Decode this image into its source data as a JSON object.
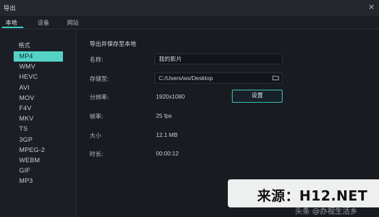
{
  "window": {
    "title": "导出",
    "close_glyph": "✕"
  },
  "tabs": [
    {
      "label": "本地"
    },
    {
      "label": "设备"
    },
    {
      "label": "网站"
    }
  ],
  "sidebar": {
    "header": "格式",
    "formats": [
      "MP4",
      "WMV",
      "HEVC",
      "AVI",
      "MOV",
      "F4V",
      "MKV",
      "TS",
      "3GP",
      "MPEG-2",
      "WEBM",
      "GIF",
      "MP3"
    ],
    "selected": "MP4"
  },
  "main": {
    "section_title": "导出并保存至本地",
    "name_label": "名称:",
    "name_value": "我的影片",
    "save_label": "存储至:",
    "save_path": "C:/Users/ws/Desktop",
    "resolution_label": "分辨率:",
    "resolution_value": "1920x1080",
    "settings_label": "设置",
    "framerate_label": "帧率:",
    "framerate_value": "25 fps",
    "size_label": "大小",
    "size_value": "12.1 MB",
    "duration_label": "时长:",
    "duration_value": "00:00:12"
  },
  "watermark": {
    "text": "来源：H12.NET",
    "corner": "头条 @办视生活乡"
  },
  "colors": {
    "accent": "#55d2c6",
    "background": "#16191e"
  },
  "icons": {
    "close": "close-icon",
    "folder": "folder-icon"
  }
}
